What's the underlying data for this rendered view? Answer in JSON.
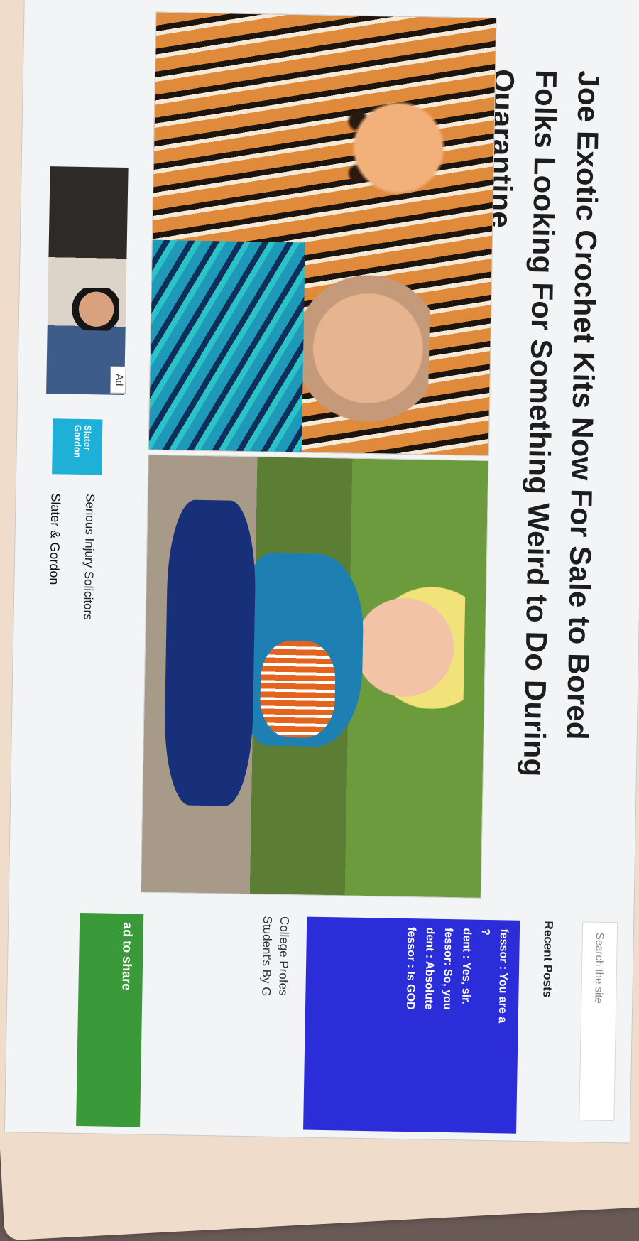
{
  "article": {
    "title": "Joe Exotic Crochet Kits Now For Sale to Bored Folks Looking For Something Weird to Do During Quarantine"
  },
  "sidebar": {
    "search_placeholder": "Search the site",
    "recent_heading": "Recent Posts",
    "recent_card_lines": [
      "fessor : You are a",
      "?",
      "dent : Yes, sir.",
      "fessor: So, you",
      "dent : Absolute",
      "fessor : Is GOD"
    ],
    "recent_caption_lines": [
      "College Profes",
      "Student's By G"
    ],
    "share_text": "ad to share"
  },
  "ad": {
    "badge": "Ad",
    "logo_text": "Slater Gordon",
    "line1": "Serious Injury Solicitors",
    "line2": "Slater & Gordon"
  },
  "colors": {
    "recent_card": "#2b2ed8",
    "share_banner": "#3a9a3a",
    "ad_logo": "#1fb0d8"
  }
}
